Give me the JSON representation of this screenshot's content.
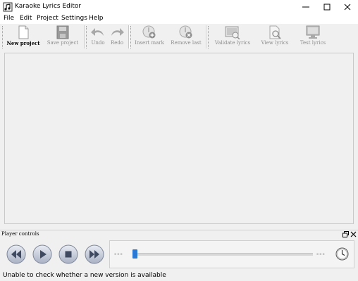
{
  "window": {
    "title": "Karaoke Lyrics Editor",
    "minimize_icon": "minimize-icon",
    "maximize_icon": "maximize-icon",
    "close_icon": "close-icon"
  },
  "menu": [
    "File",
    "Edit",
    "Project",
    "Settings",
    "Help"
  ],
  "toolbar": {
    "new_project": "New project",
    "save_project": "Save project",
    "undo": "Undo",
    "redo": "Redo",
    "insert_mark": "Insert mark",
    "remove_last": "Remove last",
    "validate_lyrics": "Validate lyrics",
    "view_lyrics": "View lyrics",
    "test_lyrics": "Test lyrics"
  },
  "player_panel": {
    "title": "Player controls",
    "position_left": "---",
    "position_right": "---",
    "slider_position": 0.0
  },
  "status": {
    "message": "Unable to check whether a new version is available"
  },
  "colors": {
    "accent": "#2b78d4",
    "background": "#f0f0f0",
    "disabled_text": "#8c8c8c"
  }
}
